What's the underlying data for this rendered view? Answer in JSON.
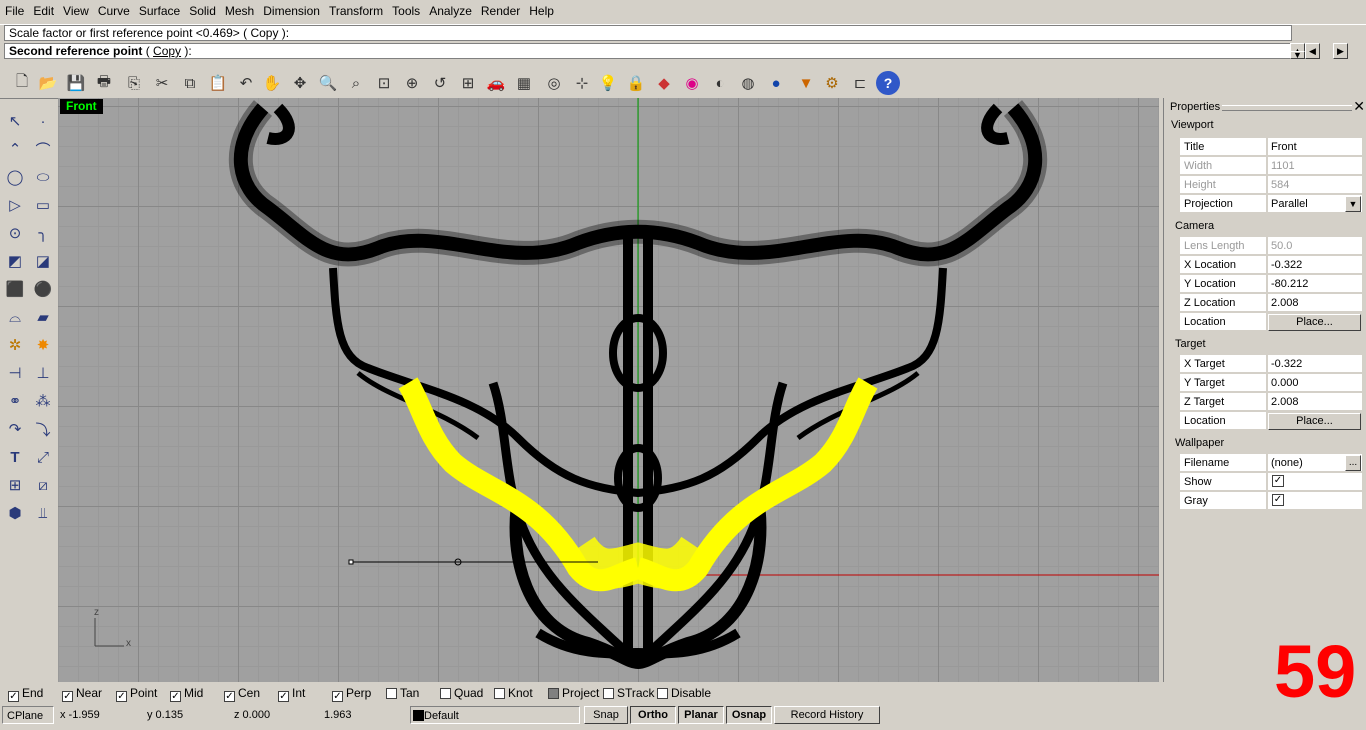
{
  "menu": [
    "File",
    "Edit",
    "View",
    "Curve",
    "Surface",
    "Solid",
    "Mesh",
    "Dimension",
    "Transform",
    "Tools",
    "Analyze",
    "Render",
    "Help"
  ],
  "command": {
    "history_line": "Scale factor or first reference point <0.469> ( Copy ):",
    "prompt_bold": "Second reference point",
    "prompt_option_open": " ( ",
    "prompt_option": "Copy",
    "prompt_option_close": " ):"
  },
  "viewport": {
    "label": "Front",
    "axis_z": "z",
    "axis_x": "x"
  },
  "properties": {
    "title": "Properties",
    "viewport_section": "Viewport",
    "rows_viewport": [
      {
        "key": "Title",
        "value": "Front"
      },
      {
        "key": "Width",
        "value": "1101"
      },
      {
        "key": "Height",
        "value": "584"
      },
      {
        "key": "Projection",
        "value": "Parallel"
      }
    ],
    "camera_section": "Camera",
    "rows_camera": [
      {
        "key": "Lens Length",
        "value": "50.0"
      },
      {
        "key": "X Location",
        "value": "-0.322"
      },
      {
        "key": "Y Location",
        "value": "-80.212"
      },
      {
        "key": "Z Location",
        "value": "2.008"
      },
      {
        "key": "Location",
        "value": "Place..."
      }
    ],
    "target_section": "Target",
    "rows_target": [
      {
        "key": "X Target",
        "value": "-0.322"
      },
      {
        "key": "Y Target",
        "value": "0.000"
      },
      {
        "key": "Z Target",
        "value": "2.008"
      },
      {
        "key": "Location",
        "value": "Place..."
      }
    ],
    "wallpaper_section": "Wallpaper",
    "rows_wallpaper": [
      {
        "key": "Filename",
        "value": "(none)",
        "btn": "..."
      },
      {
        "key": "Show",
        "checked": true
      },
      {
        "key": "Gray",
        "checked": true
      }
    ]
  },
  "osnaps": [
    {
      "label": "End",
      "checked": true
    },
    {
      "label": "Near",
      "checked": true
    },
    {
      "label": "Point",
      "checked": true
    },
    {
      "label": "Mid",
      "checked": true
    },
    {
      "label": "Cen",
      "checked": true
    },
    {
      "label": "Int",
      "checked": true
    },
    {
      "label": "Perp",
      "checked": true
    },
    {
      "label": "Tan",
      "checked": false
    },
    {
      "label": "Quad",
      "checked": false
    },
    {
      "label": "Knot",
      "checked": false
    },
    {
      "label": "Project",
      "checked": false,
      "grey": true
    },
    {
      "label": "STrack",
      "checked": false
    },
    {
      "label": "Disable",
      "checked": false
    }
  ],
  "status": {
    "cplane": "CPlane",
    "x": "x -1.959",
    "y": "y 0.135",
    "z": "z 0.000",
    "dist": "1.963",
    "layer": "Default",
    "snap": "Snap",
    "ortho": "Ortho",
    "planar": "Planar",
    "osnap": "Osnap",
    "record_history": "Record History"
  },
  "overlay_number": "59",
  "colors": {
    "selected_wire": "#ffff00",
    "wire": "#000000",
    "x_axis": "#c00000",
    "y_axis": "#00a000",
    "overlay": "#ff0000"
  }
}
